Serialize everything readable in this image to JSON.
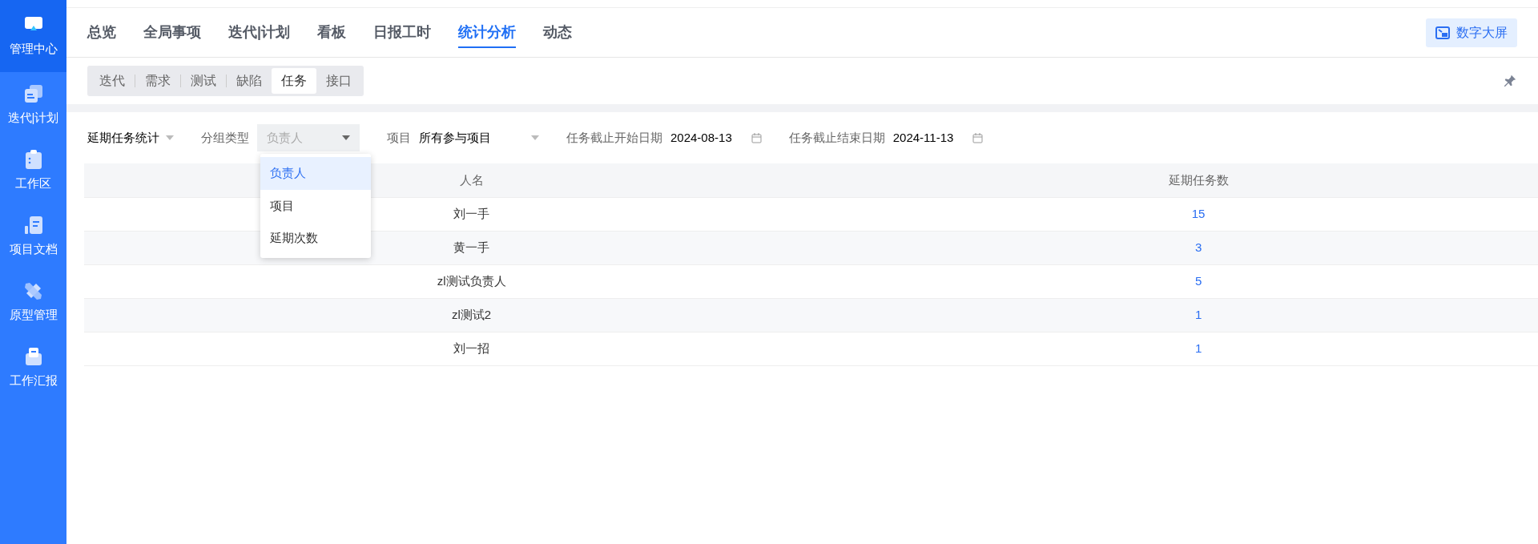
{
  "sidebar": {
    "items": [
      {
        "label": "管理中心",
        "selected": true
      },
      {
        "label": "迭代|计划",
        "selected": false
      },
      {
        "label": "工作区",
        "selected": false
      },
      {
        "label": "项目文档",
        "selected": false
      },
      {
        "label": "原型管理",
        "selected": false
      },
      {
        "label": "工作汇报",
        "selected": false
      }
    ]
  },
  "tabs": [
    {
      "label": "总览",
      "selected": false
    },
    {
      "label": "全局事项",
      "selected": false
    },
    {
      "label": "迭代|计划",
      "selected": false
    },
    {
      "label": "看板",
      "selected": false
    },
    {
      "label": "日报工时",
      "selected": false
    },
    {
      "label": "统计分析",
      "selected": true
    },
    {
      "label": "动态",
      "selected": false
    }
  ],
  "screen_button": {
    "label": "数字大屏"
  },
  "subtabs": [
    {
      "label": "迭代",
      "selected": false
    },
    {
      "label": "需求",
      "selected": false
    },
    {
      "label": "测试",
      "selected": false
    },
    {
      "label": "缺陷",
      "selected": false
    },
    {
      "label": "任务",
      "selected": true
    },
    {
      "label": "接口",
      "selected": false
    }
  ],
  "filters": {
    "report": {
      "value": "延期任务统计"
    },
    "group": {
      "label": "分组类型",
      "value": "负责人",
      "options": [
        {
          "label": "负责人",
          "selected": true
        },
        {
          "label": "项目",
          "selected": false
        },
        {
          "label": "延期次数",
          "selected": false
        }
      ]
    },
    "project": {
      "label": "项目",
      "value": "所有参与项目"
    },
    "start_date": {
      "label": "任务截止开始日期",
      "value": "2024-08-13"
    },
    "end_date": {
      "label": "任务截止结束日期",
      "value": "2024-11-13"
    }
  },
  "table": {
    "columns": [
      "人名",
      "延期任务数"
    ],
    "rows": [
      [
        "刘一手",
        "15"
      ],
      [
        "黄一手",
        "3"
      ],
      [
        "zl测试负责人",
        "5"
      ],
      [
        "zl测试2",
        "1"
      ],
      [
        "刘一招",
        "1"
      ]
    ]
  }
}
